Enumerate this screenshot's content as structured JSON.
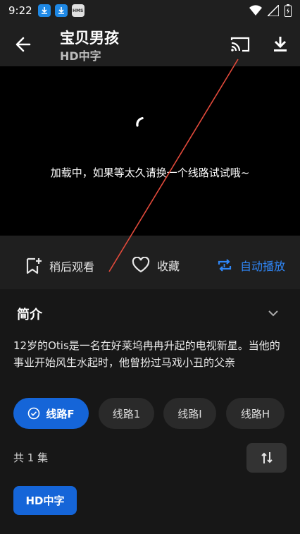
{
  "status_bar": {
    "time": "9:22",
    "hms_label": "HMS"
  },
  "appbar": {
    "title": "宝贝男孩",
    "subtitle": "HD中字",
    "icons": [
      "back-arrow-icon",
      "cast-icon",
      "download-icon"
    ]
  },
  "player": {
    "loading_text": "加载中，如果等太久请换一个线路试试哦~"
  },
  "actions": {
    "watch_later": "稍后观看",
    "favorite": "收藏",
    "autoplay": "自动播放"
  },
  "intro": {
    "title": "简介",
    "description": "12岁的Otis是一名在好莱坞冉冉升起的电视新星。当他的事业开始风生水起时，他曾扮过马戏小丑的父亲"
  },
  "routes": {
    "items": [
      "线路F",
      "线路1",
      "线路I",
      "线路H"
    ],
    "selected": "线路F"
  },
  "episodes": {
    "count_text": "共 1 集",
    "items": [
      "HD中字"
    ]
  },
  "colors": {
    "accent": "#1565d8",
    "autoplay_blue": "#2f86f6",
    "background": "#1f1f1f",
    "annotation_red": "#e24a3b"
  }
}
